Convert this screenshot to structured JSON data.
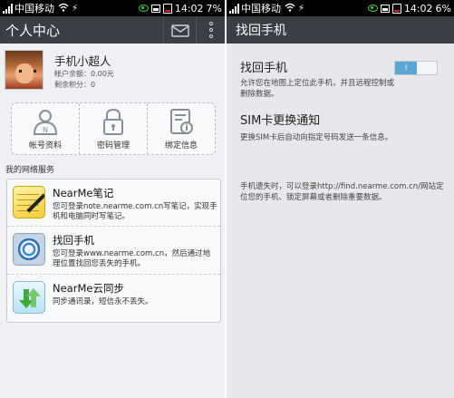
{
  "left_status": {
    "carrier": "中国移动",
    "time": "14:02",
    "battery": "7%"
  },
  "right_status": {
    "carrier": "中国移动",
    "time": "14:02",
    "battery": "6%"
  },
  "left_header": {
    "title": "个人中心",
    "mail_icon": "mail-icon",
    "more_icon": "more-vertical-icon"
  },
  "profile": {
    "name": "手机小超人",
    "balance": "帐户余额：0.00元",
    "points": "剩余积分：0"
  },
  "grid": [
    {
      "label": "帐号资料",
      "icon": "account-id-icon"
    },
    {
      "label": "密码管理",
      "icon": "lock-icon"
    },
    {
      "label": "绑定信息",
      "icon": "bind-info-icon"
    }
  ],
  "services_title": "我的网络服务",
  "services": [
    {
      "title": "NearMe笔记",
      "desc": "您可登录note.nearme.com.cn写笔记，实现手机和电脑同时写笔记。",
      "icon": "note-icon"
    },
    {
      "title": "找回手机",
      "desc": "您可登录www.nearme.com.cn，然后通过地理位置找回您丢失的手机。",
      "icon": "radar-icon"
    },
    {
      "title": "NearMe云同步",
      "desc": "同步通讯录，短信永不丢失。",
      "icon": "sync-icon"
    }
  ],
  "right_header": {
    "title": "找回手机"
  },
  "find_phone": {
    "title": "找回手机",
    "desc": "允许您在地图上定位此手机，并且远程控制或删除数据。",
    "toggle_label": "I",
    "enabled": true
  },
  "sim_notice": {
    "title": "SIM卡更换通知",
    "desc": "更换SIM卡后自动向指定号码发送一条信息。"
  },
  "footer_note": "手机遗失时，可以登录http://find.nearme.com.cn/网站定位您的手机、锁定屏幕或者删除重要数据。",
  "colors": {
    "header_bg": "#3a3f46",
    "accent": "#5ba6d4",
    "status_bar": "#000000"
  }
}
